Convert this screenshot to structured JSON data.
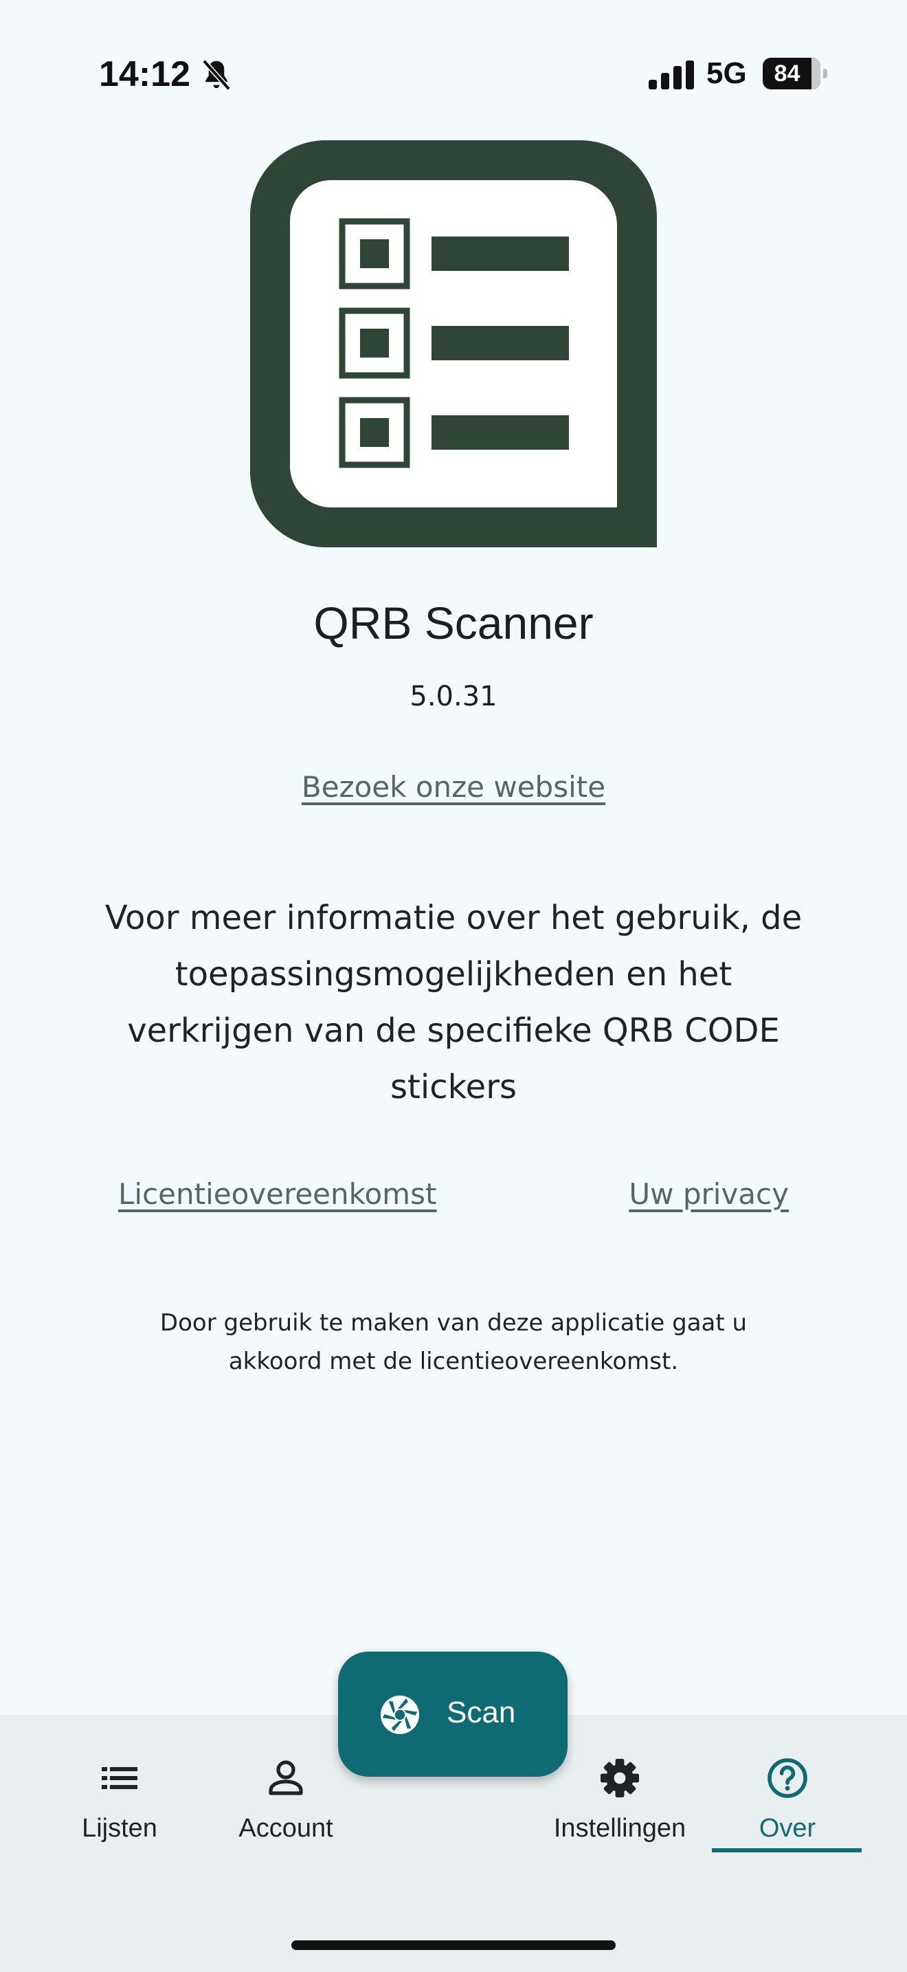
{
  "status_bar": {
    "time": "14:12",
    "network": "5G",
    "battery_level": "84",
    "battery_fraction": 0.84,
    "icons": [
      "bell-muted-icon",
      "cellular-signal-icon",
      "battery-icon"
    ]
  },
  "about": {
    "app_name": "QRB Scanner",
    "version": "5.0.31",
    "website_link": "Bezoek onze website",
    "info_text": "Voor meer informatie over het gebruik, de toepassingsmogelijkheden en het verkrijgen van de specifieke QRB CODE stickers",
    "license_link": "Licentieovereenkomst",
    "privacy_link": "Uw privacy",
    "agreement_text": "Door gebruik te maken van deze applicatie gaat u akkoord met de licentieovereenkomst."
  },
  "scan_button": {
    "label": "Scan",
    "icon": "camera-shutter-icon"
  },
  "bottom_nav": {
    "items": [
      {
        "label": "Lijsten",
        "icon": "list-icon",
        "active": false
      },
      {
        "label": "Account",
        "icon": "person-icon",
        "active": false
      },
      {
        "label": "Instellingen",
        "icon": "gear-icon",
        "active": false
      },
      {
        "label": "Over",
        "icon": "help-circle-icon",
        "active": true
      }
    ]
  },
  "colors": {
    "background": "#f4f9fb",
    "logo": "#2f4538",
    "accent": "#0f6b73",
    "link": "#55666a",
    "nav_background": "#e9eef0"
  }
}
